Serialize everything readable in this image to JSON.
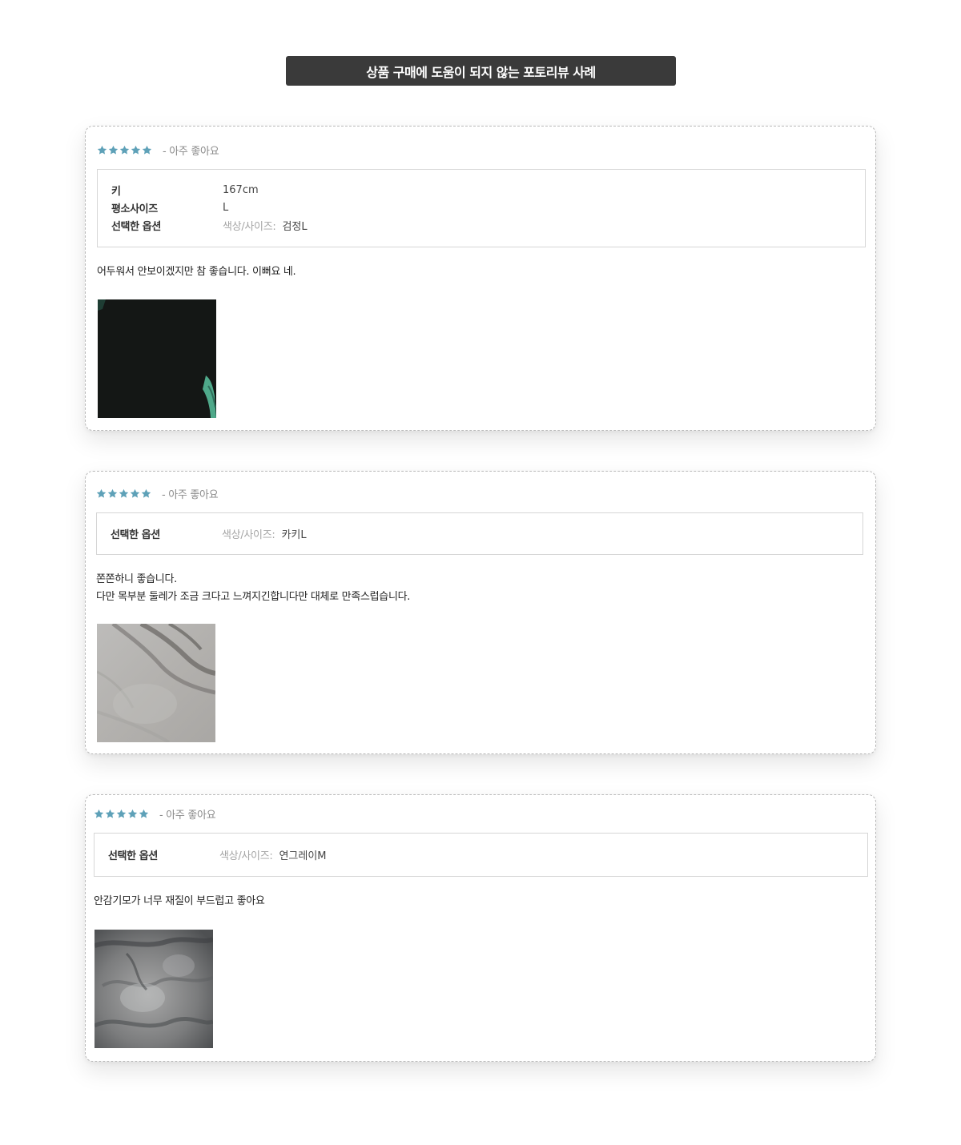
{
  "banner": {
    "title": "상품 구매에 도움이 되지 않는 포토리뷰 사례"
  },
  "colors": {
    "star": "#5ea1b8",
    "banner_bg": "#3a3a3a"
  },
  "reviews": [
    {
      "rating": 5,
      "rating_text": "- 아주 좋아요",
      "options": [
        {
          "label": "키",
          "value": "167cm"
        },
        {
          "label": "평소사이즈",
          "value": "L"
        },
        {
          "label": "선택한 옵션",
          "key": "색상/사이즈:",
          "value": "검정L"
        }
      ],
      "text_lines": [
        "어두워서 안보이겠지만 참 좋습니다. 이뻐요 네."
      ],
      "photo": "dark-photo"
    },
    {
      "rating": 5,
      "rating_text": "- 아주 좋아요",
      "options": [
        {
          "label": "선택한 옵션",
          "key": "색상/사이즈:",
          "value": "카키L"
        }
      ],
      "text_lines": [
        "쫀쫀하니 좋습니다.",
        "다만 목부분 둘레가 조금 크다고 느껴지긴합니다만 대체로 만족스럽습니다."
      ],
      "photo": "grey-fabric-photo"
    },
    {
      "rating": 5,
      "rating_text": "- 아주 좋아요",
      "options": [
        {
          "label": "선택한 옵션",
          "key": "색상/사이즈:",
          "value": "연그레이M"
        }
      ],
      "text_lines": [
        "안감기모가 너무 재질이 부드럽고 좋아요"
      ],
      "photo": "fleece-lining-photo"
    }
  ]
}
